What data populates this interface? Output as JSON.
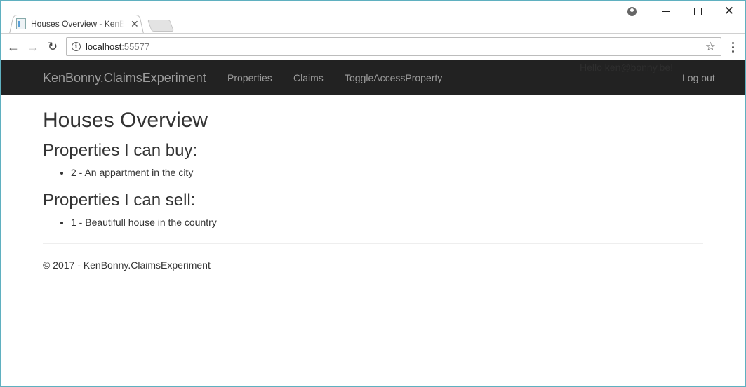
{
  "browser": {
    "tab_title": "Houses Overview - KenBonny.ClaimsExperiment",
    "tab_close": "✕",
    "url_host": "localhost",
    "url_port": ":55577",
    "back_glyph": "←",
    "forward_glyph": "→",
    "reload_glyph": "↻",
    "star_glyph": "☆",
    "close_glyph": "✕",
    "info_glyph": "i",
    "icons": [
      "favicon-icon",
      "profile-icon",
      "minimize-icon",
      "maximize-icon",
      "close-window-icon",
      "back-icon",
      "forward-icon",
      "reload-icon",
      "info-icon",
      "bookmark-star-icon",
      "menu-icon"
    ]
  },
  "navbar": {
    "brand": "KenBonny.ClaimsExperiment",
    "links": [
      "Properties",
      "Claims",
      "ToggleAccessProperty"
    ],
    "hello": "Hello ken@bonny.be!",
    "logout": "Log out",
    "background": "#222222",
    "link_color": "#9d9d9d"
  },
  "main": {
    "title": "Houses Overview",
    "buy_heading": "Properties I can buy:",
    "buy_items": [
      "2 - An appartment in the city"
    ],
    "sell_heading": "Properties I can sell:",
    "sell_items": [
      "1 - Beautifull house in the country"
    ]
  },
  "footer": {
    "text": "© 2017 - KenBonny.ClaimsExperiment"
  }
}
